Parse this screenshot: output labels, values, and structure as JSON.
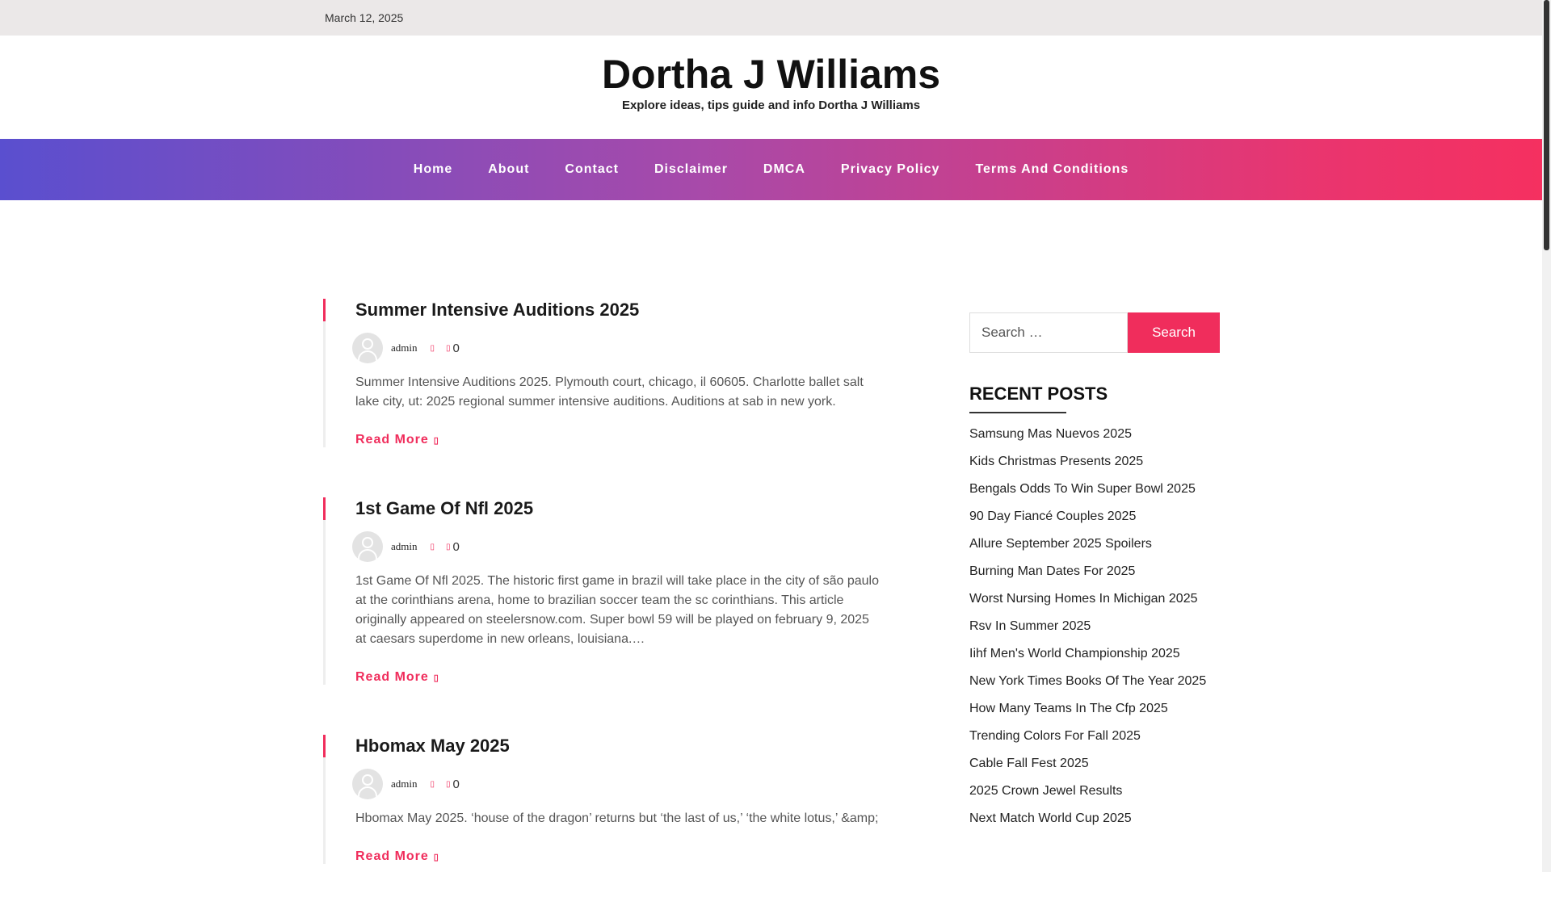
{
  "topbar": {
    "date": "March 12, 2025"
  },
  "site": {
    "title": "Dortha J Williams",
    "description": "Explore ideas, tips guide and info Dortha J Williams"
  },
  "nav": {
    "items": [
      "Home",
      "About",
      "Contact",
      "Disclaimer",
      "DMCA",
      "Privacy Policy",
      "Terms And Conditions"
    ]
  },
  "posts": [
    {
      "title": "Summer Intensive Auditions 2025",
      "author": "admin",
      "comments": "0",
      "excerpt": "Summer Intensive Auditions 2025. Plymouth court, chicago, il 60605. Charlotte ballet salt lake city, ut: 2025 regional summer intensive auditions. Auditions at sab in new york.",
      "read_more": "Read More"
    },
    {
      "title": "1st Game Of Nfl 2025",
      "author": "admin",
      "comments": "0",
      "excerpt": "1st Game Of Nfl 2025. The historic first game in brazil will take place in the city of são paulo at the corinthians arena, home to brazilian soccer team the sc corinthians. This article originally appeared on steelersnow.com. Super bowl 59 will be played on february 9, 2025 at caesars superdome in new orleans, louisiana.…",
      "read_more": "Read More"
    },
    {
      "title": "Hbomax May 2025",
      "author": "admin",
      "comments": "0",
      "excerpt": "Hbomax May 2025. ‘house of the dragon’ returns but ‘the last of us,’ ‘the white lotus,’ &amp;",
      "read_more": "Read More"
    }
  ],
  "sidebar": {
    "search_placeholder": "Search …",
    "search_button": "Search",
    "recent_title": "RECENT POSTS",
    "recent_posts": [
      "Samsung Mas Nuevos 2025",
      "Kids Christmas Presents 2025",
      "Bengals Odds To Win Super Bowl 2025",
      "90 Day Fiancé Couples 2025",
      "Allure September 2025 Spoilers",
      "Burning Man Dates For 2025",
      "Worst Nursing Homes In Michigan 2025",
      "Rsv In Summer 2025",
      "Iihf Men's World Championship 2025",
      "New York Times Books Of The Year 2025",
      "How Many Teams In The Cfp 2025",
      "Trending Colors For Fall 2025",
      "Cable Fall Fest 2025",
      "2025 Crown Jewel Results",
      "Next Match World Cup 2025"
    ]
  },
  "icons": {
    "clock": "clock-icon",
    "comment": "comment-icon",
    "read_more_arrow": "chevron-right-icon",
    "accent_color": "#f02d5c"
  }
}
